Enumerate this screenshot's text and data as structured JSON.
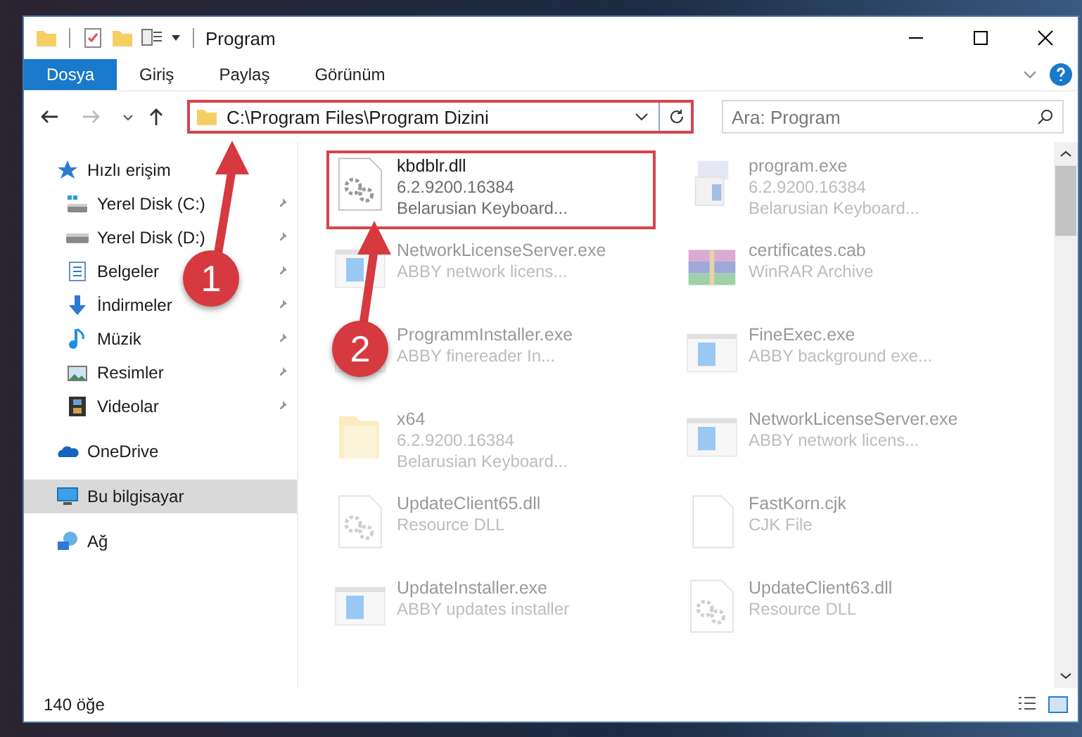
{
  "window": {
    "title": "Program"
  },
  "ribbon_tabs": [
    {
      "label": "Dosya",
      "selected": true
    },
    {
      "label": "Giriş",
      "selected": false
    },
    {
      "label": "Paylaş",
      "selected": false
    },
    {
      "label": "Görünüm",
      "selected": false
    }
  ],
  "address": {
    "path": "C:\\Program Files\\Program Dizini",
    "highlighted": true
  },
  "search": {
    "placeholder": "Ara: Program"
  },
  "sidebar": {
    "items": [
      {
        "label": "Hızlı erişim",
        "kind": "star",
        "selected": false,
        "children": [
          {
            "label": "Yerel Disk (C:)",
            "kind": "drive-system",
            "pinned": true,
            "selected": false
          },
          {
            "label": "Yerel Disk (D:)",
            "kind": "drive",
            "pinned": true,
            "selected": false
          },
          {
            "label": "Belgeler",
            "kind": "document",
            "pinned": true,
            "selected": false
          },
          {
            "label": "İndirmeler",
            "kind": "download",
            "pinned": true,
            "selected": false
          },
          {
            "label": "Müzik",
            "kind": "music",
            "pinned": true,
            "selected": false
          },
          {
            "label": "Resimler",
            "kind": "picture",
            "pinned": true,
            "selected": false
          },
          {
            "label": "Videolar",
            "kind": "video",
            "pinned": true,
            "selected": false
          }
        ]
      },
      {
        "label": "OneDrive",
        "kind": "cloud",
        "selected": false
      },
      {
        "label": "Bu bilgisayar",
        "kind": "computer",
        "selected": true
      },
      {
        "label": "Ağ",
        "kind": "network",
        "selected": false
      }
    ]
  },
  "files": [
    {
      "name": "kbdblr.dll",
      "details": [
        "6.2.9200.16384",
        "Belarusian Keyboard..."
      ],
      "kind": "dll",
      "highlighted": true,
      "dimmed": false
    },
    {
      "name": "program.exe",
      "details": [
        "6.2.9200.16384",
        "Belarusian Keyboard..."
      ],
      "kind": "setup",
      "highlighted": false,
      "dimmed": true
    },
    {
      "name": "NetworkLicenseServer.exe",
      "details": [
        "ABBY network licens..."
      ],
      "kind": "app",
      "highlighted": false,
      "dimmed": true
    },
    {
      "name": "certificates.cab",
      "details": [
        "WinRAR Archive"
      ],
      "kind": "archive",
      "highlighted": false,
      "dimmed": true
    },
    {
      "name": "ProgrammInstaller.exe",
      "details": [
        "ABBY finereader In..."
      ],
      "kind": "app",
      "highlighted": false,
      "dimmed": true
    },
    {
      "name": "FineExec.exe",
      "details": [
        "ABBY background exe..."
      ],
      "kind": "app",
      "highlighted": false,
      "dimmed": true
    },
    {
      "name": "x64",
      "details": [
        "6.2.9200.16384",
        "Belarusian Keyboard..."
      ],
      "kind": "folder",
      "highlighted": false,
      "dimmed": true
    },
    {
      "name": "NetworkLicenseServer.exe",
      "details": [
        "ABBY network licens..."
      ],
      "kind": "app",
      "highlighted": false,
      "dimmed": true
    },
    {
      "name": "UpdateClient65.dll",
      "details": [
        "Resource DLL"
      ],
      "kind": "dll",
      "highlighted": false,
      "dimmed": true
    },
    {
      "name": "FastKorn.cjk",
      "details": [
        "CJK File"
      ],
      "kind": "file",
      "highlighted": false,
      "dimmed": true
    },
    {
      "name": "UpdateInstaller.exe",
      "details": [
        "ABBY updates installer"
      ],
      "kind": "app",
      "highlighted": false,
      "dimmed": true
    },
    {
      "name": "UpdateClient63.dll",
      "details": [
        "Resource DLL"
      ],
      "kind": "dll",
      "highlighted": false,
      "dimmed": true
    }
  ],
  "annotations": [
    {
      "label": "1"
    },
    {
      "label": "2"
    }
  ],
  "status_bar": {
    "item_count": "140 öğe"
  }
}
